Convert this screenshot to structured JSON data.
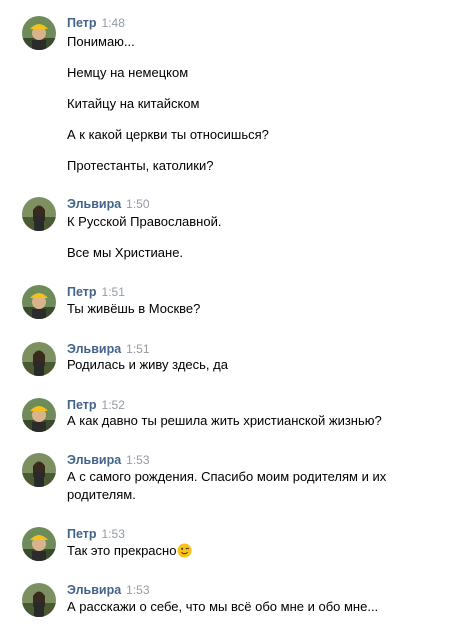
{
  "groups": [
    {
      "sender": "Петр",
      "time": "1:48",
      "avatar": "avatar-petr",
      "messages": [
        "Понимаю...",
        "Немцу на немецком",
        "Китайцу на китайском",
        "А к какой церкви ты относишься?",
        "Протестанты, католики?"
      ]
    },
    {
      "sender": "Эльвира",
      "time": "1:50",
      "avatar": "avatar-elvira",
      "messages": [
        "К Русской Православной.",
        "Все мы Христиане."
      ]
    },
    {
      "sender": "Петр",
      "time": "1:51",
      "avatar": "avatar-petr",
      "messages": [
        "Ты живёшь в Москве?"
      ]
    },
    {
      "sender": "Эльвира",
      "time": "1:51",
      "avatar": "avatar-elvira",
      "messages": [
        "Родилась и живу здесь, да"
      ]
    },
    {
      "sender": "Петр",
      "time": "1:52",
      "avatar": "avatar-petr",
      "messages": [
        "А как давно ты решила жить христианской жизнью?"
      ]
    },
    {
      "sender": "Эльвира",
      "time": "1:53",
      "avatar": "avatar-elvira",
      "messages": [
        "А с самого рождения. Спасибо моим родителям и их родителям."
      ]
    },
    {
      "sender": "Петр",
      "time": "1:53",
      "avatar": "avatar-petr",
      "messages": [
        "Так это прекрасно"
      ],
      "emoji": "wink-emoji-icon"
    },
    {
      "sender": "Эльвира",
      "time": "1:53",
      "avatar": "avatar-elvira",
      "messages": [
        "А расскажи о себе, что мы всё обо мне и обо мне..."
      ]
    }
  ],
  "colors": {
    "sender_name": "#42648b",
    "timestamp": "#939ba5",
    "message_text": "#000000",
    "background": "#ffffff"
  }
}
